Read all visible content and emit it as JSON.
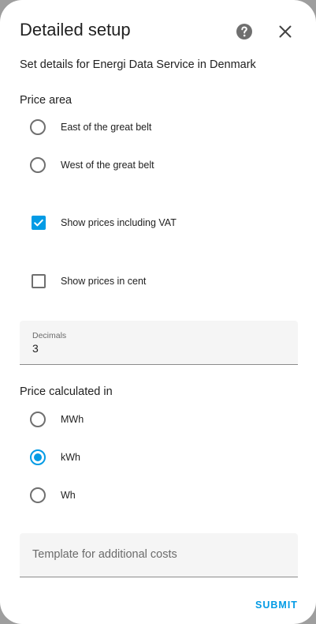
{
  "dialog": {
    "title": "Detailed setup",
    "description": "Set details for Energi Data Service in Denmark",
    "icons": {
      "help": "help-circle-icon",
      "close": "close-icon"
    }
  },
  "price_area": {
    "label": "Price area",
    "options": [
      {
        "label": "East of the great belt",
        "selected": false
      },
      {
        "label": "West of the great belt",
        "selected": false
      }
    ]
  },
  "vat": {
    "label": "Show prices including VAT",
    "checked": true
  },
  "cent": {
    "label": "Show prices in cent",
    "checked": false
  },
  "decimals": {
    "label": "Decimals",
    "value": "3"
  },
  "price_unit": {
    "label": "Price calculated in",
    "options": [
      {
        "label": "MWh",
        "selected": false
      },
      {
        "label": "kWh",
        "selected": true
      },
      {
        "label": "Wh",
        "selected": false
      }
    ]
  },
  "template": {
    "placeholder": "Template for additional costs",
    "value": ""
  },
  "submit": {
    "label": "SUBMIT"
  },
  "colors": {
    "accent": "#039be5",
    "text": "#212121",
    "secondary_text": "#6b6b6b",
    "field_bg": "#f5f5f5"
  }
}
